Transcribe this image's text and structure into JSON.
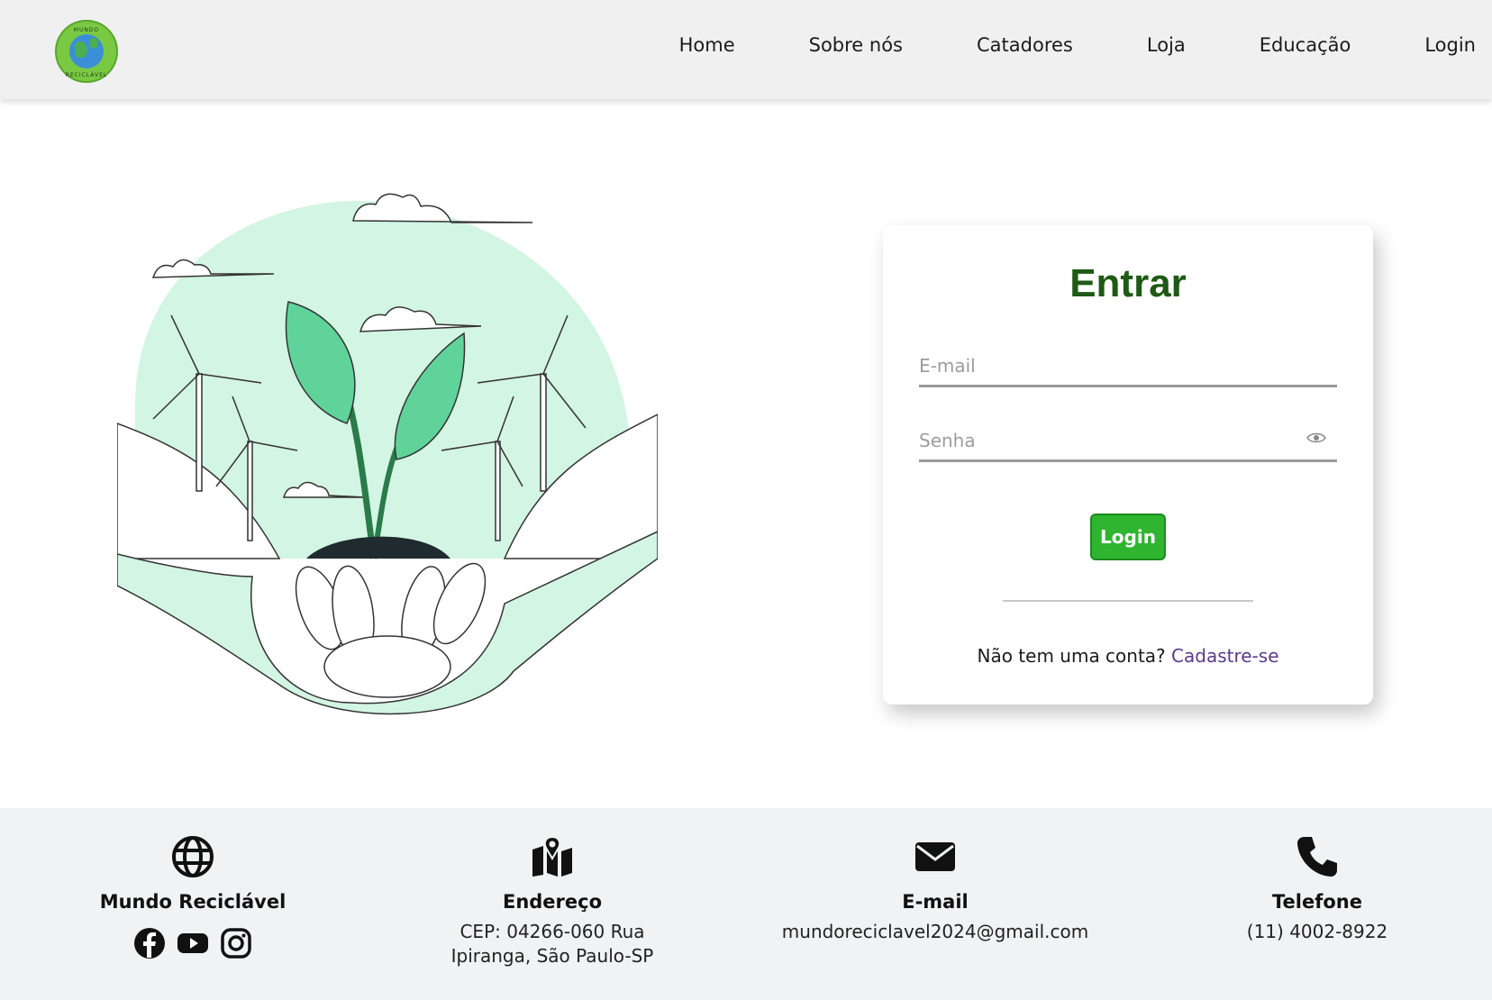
{
  "header": {
    "logo_text_top": "MUNDO",
    "logo_text_bottom": "RECICLÁVEL",
    "nav": [
      {
        "label": "Home"
      },
      {
        "label": "Sobre nós"
      },
      {
        "label": "Catadores"
      },
      {
        "label": "Loja"
      },
      {
        "label": "Educação"
      },
      {
        "label": "Login"
      }
    ]
  },
  "login": {
    "title": "Entrar",
    "email_placeholder": "E-mail",
    "password_placeholder": "Senha",
    "button_label": "Login",
    "no_account_text": "Não tem uma conta? ",
    "signup_link": "Cadastre-se"
  },
  "footer": {
    "brand": {
      "title": "Mundo Reciclável",
      "icon": "globe-icon",
      "socials": [
        "facebook-icon",
        "youtube-icon",
        "instagram-icon"
      ]
    },
    "address": {
      "title": "Endereço",
      "icon": "map-location-icon",
      "line1": "CEP: 04266-060 Rua",
      "line2": "Ipiranga, São Paulo-SP"
    },
    "email": {
      "title": "E-mail",
      "icon": "envelope-icon",
      "value": "mundoreciclavel2024@gmail.com"
    },
    "phone": {
      "title": "Telefone",
      "icon": "phone-icon",
      "value": "(11) 4002-8922"
    }
  },
  "colors": {
    "accent_green": "#2fb52f",
    "title_green": "#1e5a14",
    "link_purple": "#5b3a8a",
    "illustration_mint": "#d3f5e3"
  }
}
